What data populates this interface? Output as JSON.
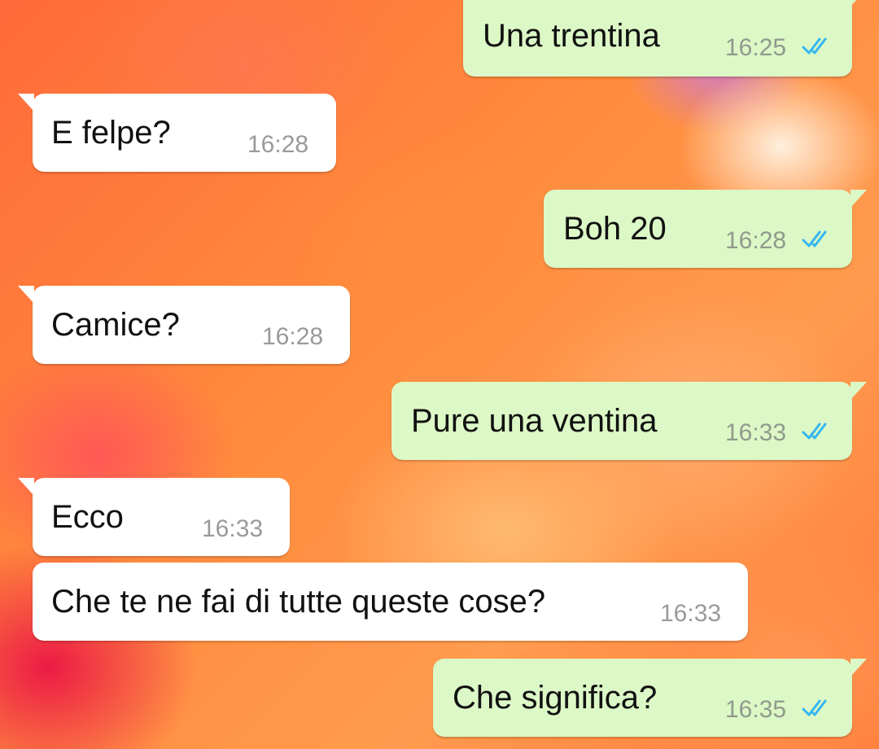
{
  "messages": [
    {
      "direction": "outgoing",
      "text": "Una trentina",
      "time": "16:25",
      "status": "read-double-check-icon"
    },
    {
      "direction": "incoming",
      "text": "E felpe?",
      "time": "16:28"
    },
    {
      "direction": "outgoing",
      "text": "Boh 20",
      "time": "16:28",
      "status": "read-double-check-icon"
    },
    {
      "direction": "incoming",
      "text": "Camice?",
      "time": "16:28"
    },
    {
      "direction": "outgoing",
      "text": "Pure una ventina",
      "time": "16:33",
      "status": "read-double-check-icon"
    },
    {
      "direction": "incoming",
      "text": "Ecco",
      "time": "16:33"
    },
    {
      "direction": "incoming",
      "text": "Che te ne fai di tutte queste cose?",
      "time": "16:33"
    },
    {
      "direction": "outgoing",
      "text": "Che significa?",
      "time": "16:35",
      "status": "read-double-check-icon"
    }
  ],
  "colors": {
    "outgoing_bubble": "#dcf8c6",
    "incoming_bubble": "#ffffff",
    "read_ticks": "#34b7f1",
    "background": "#ff8a3c"
  }
}
